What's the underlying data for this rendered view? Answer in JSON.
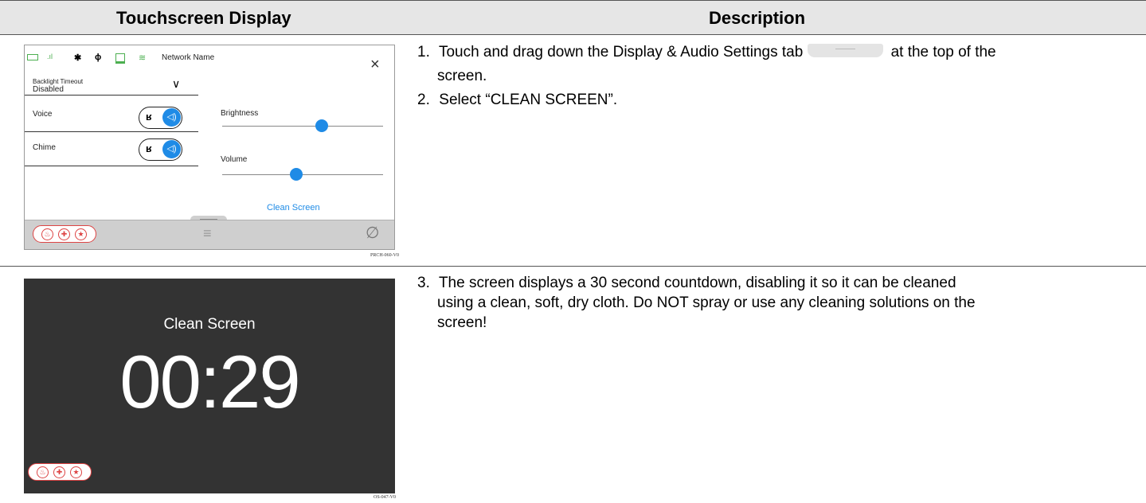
{
  "table": {
    "headers": {
      "display": "Touchscreen Display",
      "description": "Description"
    },
    "row1": {
      "steps": [
        {
          "num": "1.",
          "pre": "Touch and drag down the Display & Audio Settings tab",
          "post": "at the top of the",
          "cont": "screen."
        },
        {
          "num": "2.",
          "text": "Select “CLEAN SCREEN”."
        }
      ],
      "figure_id": "PRCH-060-V0"
    },
    "row2": {
      "step": {
        "num": "3.",
        "line1": "The screen displays a 30 second countdown, disabling it so it can be cleaned",
        "line2": "using a clean, soft, dry cloth.  Do NOT spray or use any cleaning solutions on the",
        "line3": "screen!"
      },
      "figure_id": "OS-047-V0"
    }
  },
  "settings_screen": {
    "network_name": "Network Name",
    "backlight_label": "Backlight Timeout",
    "backlight_value": "Disabled",
    "voice_label": "Voice",
    "chime_label": "Chime",
    "brightness_label": "Brightness",
    "volume_label": "Volume",
    "brightness_level": 0.62,
    "volume_level": 0.46,
    "clean_screen_button": "Clean Screen",
    "accent": "#1f8be6",
    "status_green": "#4caf50",
    "alarm_red": "#d44444"
  },
  "clean_screen": {
    "title": "Clean Screen",
    "countdown": "00:29",
    "background": "#333333"
  }
}
